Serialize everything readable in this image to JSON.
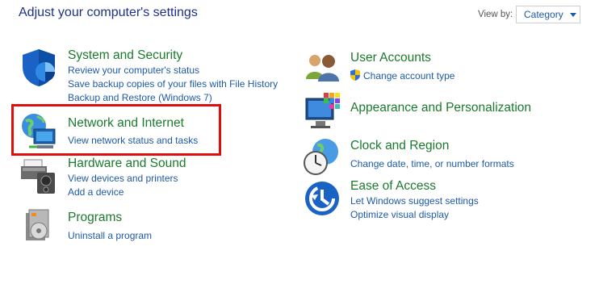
{
  "header": {
    "title": "Adjust your computer's settings",
    "view_by_label": "View by:",
    "view_by_value": "Category"
  },
  "categories": {
    "system": {
      "title": "System and Security",
      "links": [
        "Review your computer's status",
        "Save backup copies of your files with File History",
        "Backup and Restore (Windows 7)"
      ]
    },
    "network": {
      "title": "Network and Internet",
      "links": [
        "View network status and tasks"
      ]
    },
    "hardware": {
      "title": "Hardware and Sound",
      "links": [
        "View devices and printers",
        "Add a device"
      ]
    },
    "programs": {
      "title": "Programs",
      "links": [
        "Uninstall a program"
      ]
    },
    "users": {
      "title": "User Accounts",
      "links": [
        "Change account type"
      ]
    },
    "appearance": {
      "title": "Appearance and Personalization",
      "links": []
    },
    "clock": {
      "title": "Clock and Region",
      "links": [
        "Change date, time, or number formats"
      ]
    },
    "ease": {
      "title": "Ease of Access",
      "links": [
        "Let Windows suggest settings",
        "Optimize visual display"
      ]
    }
  },
  "colors": {
    "heading": "#1e3287",
    "category_title": "#1b7a2c",
    "link": "#1e5aa8",
    "highlight": "#e00d0d"
  }
}
